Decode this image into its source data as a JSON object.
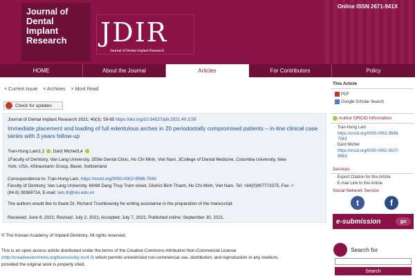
{
  "header": {
    "logo_lines": [
      "Journal of",
      "Dental",
      "Implant",
      "Research"
    ],
    "brand": "JDIR",
    "brand_sub": "Journal of Dental Implant Research",
    "issn": "Online ISSN 2671-941X"
  },
  "nav": [
    {
      "label": "HOME"
    },
    {
      "label": "About the Journal"
    },
    {
      "label": "Articles"
    },
    {
      "label": "For Contributors"
    },
    {
      "label": "Policy"
    }
  ],
  "subtabs": [
    "× Current Issue",
    "× Archives",
    "× Most Read"
  ],
  "check_updates": "Check for updates",
  "article": {
    "citation": "Journal of Dental Implant Research 2021; 40(3): 59-65",
    "doi": "https://doi.org/10.54527/jdir.2021.40.3.59",
    "title": "Immediate placement and loading of full edentulous arches in 20 periodontally compromised patients – in-line clinical case series with 3 years follow-up",
    "authors": "Tran-Hung Lam1,2",
    "authors2": "Dard Michel3,4",
    "affil1": "1Faculty of Dentistry, Van Lang University, 2Elite Dental Clinic, Ho Chi Minh, Viet Nam, 3College of Dental Medicine, Columbia University, New",
    "affil2": "York, USA, 4Straumann Group, Basel, Switzerland",
    "corr_prefix": "Correspondence to: Tran-Hung Lam,",
    "corr_orcid": "https://orcid.org/0000-0002-9598-7543",
    "corr_line2": "Faculty of Dentistry, Van Lang University, 69/68 Dang Thuy Tram street, District Binh Thanh, Ho Chi Minh, Viet Nam. Tel: +84(0)907773375, Fax: +",
    "corr_line3_prefix": "(84.8) 38369716, E-mail:",
    "email": "lam.th@vlu.edu.vn",
    "ack": "The authors would like to thank Dr. Richard Trushkowsky for writing assistance in the preparation of the manuscript.",
    "dates": "Received: June 8, 2021; Revised: July 2, 2021; Accepted: July 7, 2021; Published online: September 30, 2021."
  },
  "copyright": "© The Korean Academy of Implant Dentistry. All rights reserved.",
  "license1": "This is an open access article distributed under the terms of the Creative Commons Attribution Non-Commercial License",
  "license2_link": "(http://creativecommons.org/licenses/by-nc/4.0)",
  "license2_rest": " which permits unrestricted non-commercial use, distribution, and reproduction in any medium,",
  "license3": "provided the original work is properly cited.",
  "sidebar": {
    "this_article": "This Article",
    "pdf": "PDF",
    "scholar": "Google Scholar Search",
    "orcid_head": "Author ORCID Information",
    "author1": "· Tran-Hung Lam",
    "author1_orcid_a": "https://orcid.org/0000-0002-9598-",
    "author1_orcid_b": "7543",
    "author2": "· Dard Michel",
    "author2_orcid_a": "https://orcid.org/0000-0002-9107-",
    "author2_orcid_b": "996X",
    "services": "Services",
    "export": "· Export Citation for this Article",
    "email_link": "· E-mail Link to this Article",
    "social": "Social Network Service",
    "esub": "e-submission",
    "go": "go",
    "search_for": "Search for",
    "search_btn": "Search"
  }
}
